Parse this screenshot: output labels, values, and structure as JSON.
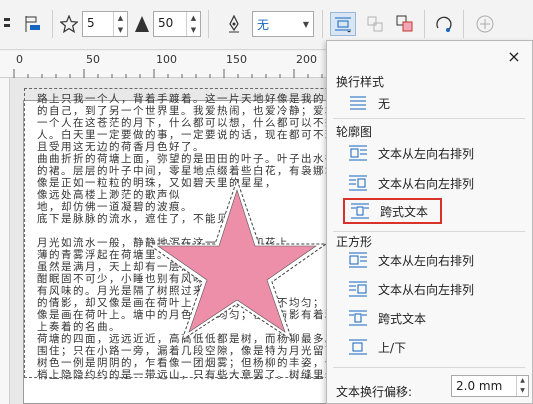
{
  "toolbar": {
    "points_value": "5",
    "sharpness_value": "50",
    "wrap_value": "无",
    "icons": [
      "align-icon",
      "star-icon",
      "sharpness-icon",
      "pen-icon",
      "text-wrap-icon",
      "copy-properties-icon",
      "weld-icon",
      "transform-icon",
      "add-icon"
    ]
  },
  "ruler": {
    "labels": [
      "0",
      "50",
      "100",
      "150",
      "200"
    ]
  },
  "document": {
    "lines": [
      "路上只我一个人，背着手踱着。这一片天地好像是我的；",
      "的自己，到了另一个世界里。我爱热闹，也爱冷静；爱群居，也",
      "一个人在这苍茫的月下，什么都可以想，什么都可以不想，",
      "人。白天里一定要做的事，一定要说的话，现在都可不理。这",
      "且受用这无边的荷香月色好了。",
      "曲曲折折的荷塘上面，弥望的是田田的叶子。叶子出水很高",
      "的裙。层层的叶子中间，零星地点缀着些白花，有袅娜地开着",
      "像是正如一粒粒的明珠，又如碧天里的星星，",
      "像远处高楼上渺茫的歌声似",
      "地，却仿佛一道凝碧的波痕。",
      "底下是脉脉的流水，遮住了，不能见",
      "",
      "月光如流水一般，静静地泻在这一片叶子和花上。",
      "薄的青雾浮起在荷塘里。叶子和花仿佛在牛乳中",
      "虽然是满月，天上却有一层淡淡的云",
      "酣眠固不可少，小睡也别有风味的。",
      "有风味的。月光是隔了树照过来的，高处丛生",
      "的倩影，却又像是画在荷叶上。塘中的月色并不均匀；",
      "像是画在荷叶上。塘中的月色并不均匀；但光与影有着和谐",
      "上奏着的名曲。",
      "荷塘的四面，远远近近，高高低低都是树，而杨柳最多。这些",
      "围住；只在小路一旁，漏着几段空隙，像是特为月光留下的。",
      "树色一例是阴阴的，乍看像一团烟雾；但杨柳的丰姿，便在",
      "梢上隐隐约约的是一带远山，只有些大意罢了。树缝里也漏着"
    ]
  },
  "panel": {
    "close_label": "×",
    "sections": {
      "wrap_style": "换行样式",
      "contour": "轮廓图",
      "square": "正方形"
    },
    "items": {
      "none": "无",
      "contour_lr": "文本从左向右排列",
      "contour_rl": "文本从右向左排列",
      "contour_straddle": "跨式文本",
      "square_lr": "文本从左向右排列",
      "square_rl": "文本从右向左排列",
      "square_straddle": "跨式文本",
      "square_topbottom": "上/下"
    },
    "offset_label": "文本换行偏移:",
    "offset_value": "2.0 mm",
    "highlight_color": "#d9322b"
  }
}
